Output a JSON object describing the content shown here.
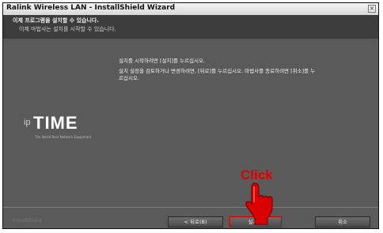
{
  "window": {
    "title": "Ralink Wireless LAN - InstallShield Wizard",
    "close_icon": "×"
  },
  "header": {
    "line1": "이제 프로그램을 설치할 수 있습니다.",
    "line2": "이제 마법사는 설치를 시작할 수 있습니다."
  },
  "body": {
    "line1": "설치를 시작하려면 [설치]를 누르십시오.",
    "line2": "설치 설정을 검토하거나 변경하려면, [뒤로]를 누르십시오. 마법사를 종료하려면 [취소]를 누",
    "line3": "르십시오."
  },
  "logo": {
    "prefix": "ip",
    "name": "TIME",
    "tagline": "The World Best Network Equipment"
  },
  "footer": {
    "brand": "InstallShield"
  },
  "buttons": {
    "back": "< 뒤로(B)",
    "install": "설치(I)",
    "cancel": "취소"
  },
  "annotation": {
    "label": "Click",
    "color": "#e00000",
    "icon": "pointing-hand-icon"
  },
  "colors": {
    "dialog_bg": "#5a5a5a",
    "header_bg": "#3c3c3c",
    "highlight": "#cc0000"
  }
}
